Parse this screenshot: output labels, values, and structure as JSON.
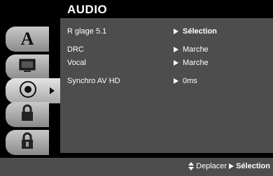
{
  "header": {
    "title": "AUDIO"
  },
  "tabs": [
    {
      "icon": "letter-a-icon",
      "glyph": "A"
    },
    {
      "icon": "monitor-icon"
    },
    {
      "icon": "speaker-icon",
      "selected": true
    },
    {
      "icon": "lock-icon"
    },
    {
      "icon": "lock-key-icon"
    }
  ],
  "menu": {
    "items": [
      {
        "label": "R glage 5.1",
        "value": "Sélection",
        "selected": true
      },
      {
        "label": "DRC",
        "value": "Marche"
      },
      {
        "label": "Vocal",
        "value": "Marche"
      },
      {
        "label": "Synchro AV HD",
        "value": "0ms"
      }
    ]
  },
  "footer": {
    "move": "Deplacer",
    "select": "Sélection"
  },
  "colors": {
    "panel": "#4d4d4d",
    "background": "#000000",
    "text": "#ffffff"
  }
}
